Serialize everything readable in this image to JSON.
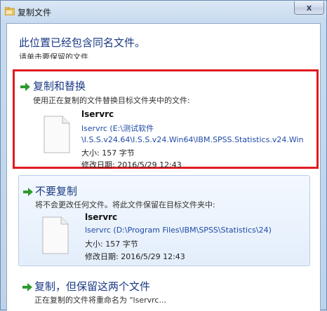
{
  "window": {
    "title": "复制文件",
    "close_label": "x"
  },
  "dialog": {
    "heading": "此位置已经包含同名文件。",
    "sub_heading": "请单击要保留的文件"
  },
  "options": {
    "replace": {
      "title": "复制和替换",
      "desc": "使用正在复制的文件替换目标文件夹中的文件:",
      "file": {
        "name": "lservrc",
        "path_line1": "lservrc (E:\\测试软件",
        "path_line2": "\\I.S.S.v24.64\\I.S.S.v24.Win64\\IBM.SPSS.Statistics.v24.Win",
        "size": "大小: 157 字节",
        "modified": "修改日期: 2016/5/29 12:43"
      }
    },
    "skip": {
      "title": "不要复制",
      "desc": "将不会更改任何文件。将此文件保留在目标文件夹中:",
      "file": {
        "name": "lservrc",
        "path": "lservrc (D:\\Program Files\\IBM\\SPSS\\Statistics\\24)",
        "size": "大小: 157 字节",
        "modified": "修改日期: 2016/5/29 12:43"
      }
    },
    "keep": {
      "title": "复制，但保留这两个文件",
      "desc": "正在复制的文件将重命名为 \"lservrc..."
    }
  },
  "colors": {
    "accent_blue": "#1a3a84",
    "link_blue": "#1f4aa8",
    "highlight_red": "#e01b22",
    "arrow_green": "#2e9a2e"
  },
  "icons": {
    "title": "copy-folder-icon",
    "arrow": "green-arrow-icon",
    "file": "blank-file-icon"
  }
}
